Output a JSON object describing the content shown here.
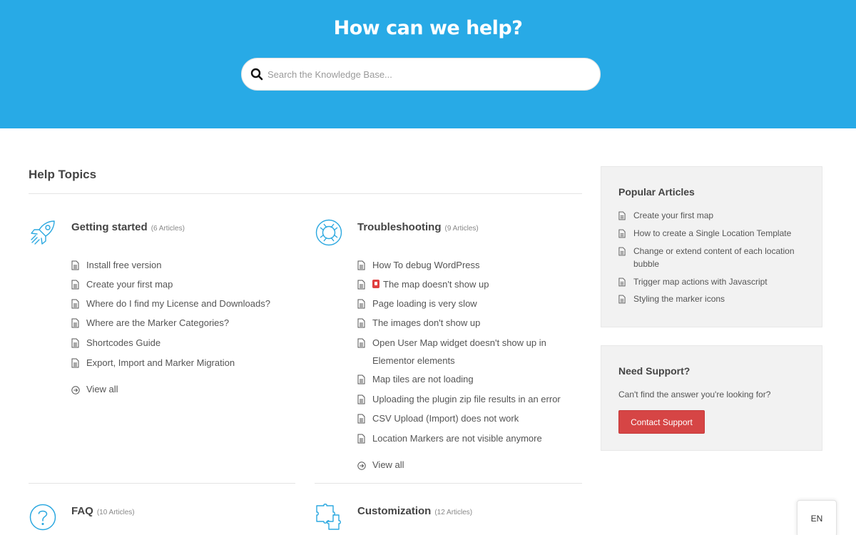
{
  "hero": {
    "title": "How can we help?",
    "search_placeholder": "Search the Knowledge Base..."
  },
  "help_topics": {
    "title": "Help Topics",
    "topics": [
      {
        "name": "Getting started",
        "count": "(6 Articles)",
        "icon": "rocket-icon",
        "articles": [
          "Install free version",
          "Create your first map",
          "Where do I find my License and Downloads?",
          "Where are the Marker Categories?",
          "Shortcodes Guide",
          "Export, Import and Marker Migration"
        ],
        "view_all": "View all"
      },
      {
        "name": "Troubleshooting",
        "count": "(9 Articles)",
        "icon": "lifebuoy-icon",
        "articles": [
          "How To debug WordPress",
          "The map doesn't show up",
          "Page loading is very slow",
          "The images don't show up",
          "Open User Map widget doesn't show up in Elementor elements",
          "Map tiles are not loading",
          "Uploading the plugin zip file results in an error",
          "CSV Upload (Import) does not work",
          "Location Markers are not visible anymore"
        ],
        "view_all": "View all"
      },
      {
        "name": "FAQ",
        "count": "(10 Articles)",
        "icon": "question-icon"
      },
      {
        "name": "Customization",
        "count": "(12 Articles)",
        "icon": "puzzle-icon"
      }
    ]
  },
  "popular": {
    "title": "Popular Articles",
    "articles": [
      "Create your first map",
      "How to create a Single Location Template",
      "Change or extend content of each location bubble",
      "Trigger map actions with Javascript",
      "Styling the marker icons"
    ]
  },
  "support": {
    "title": "Need Support?",
    "question": "Can't find the answer you're looking for?",
    "button": "Contact Support"
  },
  "language": "EN",
  "colors": {
    "hero": "#28aae6",
    "icon": "#2ba8e0",
    "button": "#d64545",
    "panel": "#f2f2f2"
  }
}
